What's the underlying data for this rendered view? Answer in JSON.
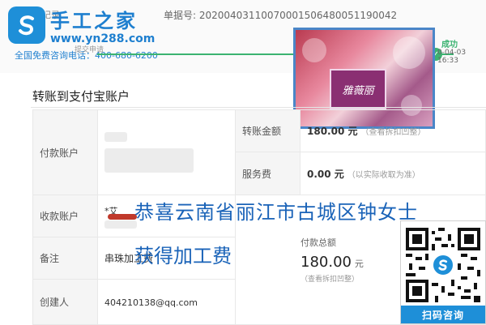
{
  "watermark": {
    "brand": "手工之家",
    "url": "www.yn288.com",
    "hotline": "全国免费咨询电话：400-680-6200"
  },
  "header": {
    "back_label": "返回记录",
    "bill_no": "单据号: 2020040311007000150648005119004​2"
  },
  "progress": {
    "step_label": "提交申请",
    "success_label": "成功",
    "success_time": "0-04-03 16:33"
  },
  "ad": {
    "box_label": "雅薇丽"
  },
  "section_title": "转账到支付宝账户",
  "table": {
    "payer_label": "付款账户",
    "payee_label": "收款账户",
    "payee_value": "*艾",
    "remark_label": "备注",
    "remark_value": "串珠加工费",
    "creator_label": "创建人",
    "creator_value": "404210138@qq.com",
    "amount_label": "转账金额",
    "amount_value": "180.00 元",
    "amount_note": "（查看拆扣凹整）",
    "fee_label": "服务费",
    "fee_value": "0.00 元",
    "fee_note": "（以实际收取为准）",
    "total_label": "付款总额",
    "total_value": "180.00",
    "total_unit": "元",
    "total_note": "（查看拆扣凹整）"
  },
  "overlay": {
    "line1": "恭喜云南省丽江市古城区钟女士",
    "line2": "获得加工费"
  },
  "qr": {
    "caption": "扫码咨询"
  },
  "colors": {
    "brand_blue": "#1e7fcf",
    "success_green": "#3cb371",
    "overlay_blue": "#1a63b8"
  }
}
